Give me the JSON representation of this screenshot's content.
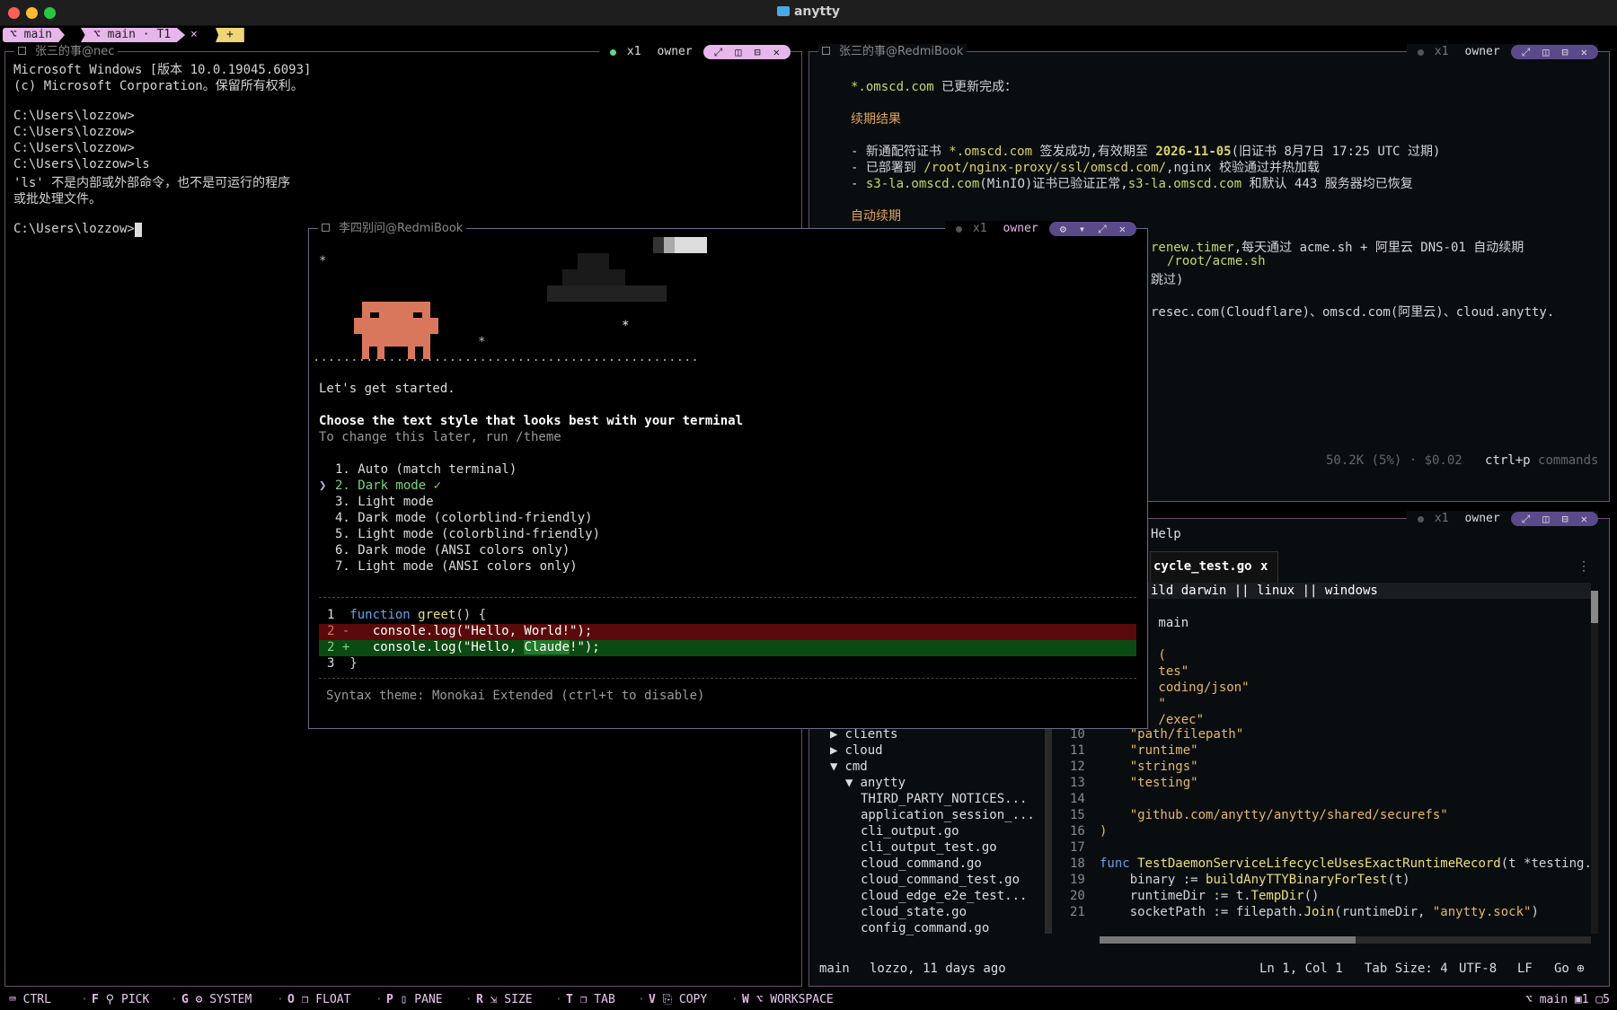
{
  "app": {
    "title": "anytty"
  },
  "tabstrip": {
    "session": "⌥ main",
    "tab": "⌥ main · T1",
    "close": "×",
    "add": "+"
  },
  "panes": {
    "left": {
      "title": "张三的事@nec",
      "x1": "x1",
      "owner": "owner",
      "lines": [
        "Microsoft Windows [版本 10.0.19045.6093]",
        "(c) Microsoft Corporation。保留所有权利。",
        "",
        "C:\\Users\\lozzow>",
        "C:\\Users\\lozzow>",
        "C:\\Users\\lozzow>",
        "C:\\Users\\lozzow>ls",
        "'ls' 不是内部或外部命令，也不是可运行的程序",
        "或批处理文件。",
        "",
        "C:\\Users\\lozzow>"
      ]
    },
    "top_right": {
      "title": "张三的事@RedmiBook",
      "x1": "x1",
      "owner": "owner",
      "l1a": "*.omscd.com",
      "l1b": " 已更新完成：",
      "h1": "续期结果",
      "r1a": "- 新通配符证书 ",
      "r1b": "*.omscd.com",
      "r1c": " 签发成功,有效期至 ",
      "r1d": "2026-11-05",
      "r1e": "(旧证书 8月7日 17:25 UTC 过期)",
      "r2a": "- 已部署到 ",
      "r2b": "/root/nginx-proxy/ssl/omscd.com/",
      "r2c": ",nginx 校验通过并热加载",
      "r3a": "- ",
      "r3b": "s3-la.omscd.com",
      "r3c": "(MinIO)证书已验证正常,",
      "r3d": "s3-la.omscd.com",
      "r3e": " 和默认 443 服务器均已恢复",
      "h2": "自动续期",
      "a1a": "renew.timer",
      "a1b": ",每天通过 acme.sh + 阿里云 DNS-01 自动续期",
      "a2": "/root/acme.sh",
      "a3": "跳过)",
      "a4": "resec.com(Cloudflare)、omscd.com(阿里云)、cloud.anytty.",
      "usage": "50.2K (5%) · $0.02",
      "cmd_key": "ctrl+p",
      "cmd_label": "commands"
    },
    "bottom_right": {
      "x1": "x1",
      "owner": "owner",
      "menu_help": "Help",
      "tab_file": "cycle_test.go",
      "tab_close": "x",
      "more": "⋮",
      "code_top": [
        "ild darwin || linux || windows",
        "",
        " main",
        "",
        " (",
        " tes\"",
        " coding/json\"",
        " \"",
        " /exec\""
      ],
      "tree": [
        {
          "indent": 0,
          "arrow": "▶",
          "name": "clients"
        },
        {
          "indent": 0,
          "arrow": "▶",
          "name": "cloud"
        },
        {
          "indent": 0,
          "arrow": "▼",
          "name": "cmd"
        },
        {
          "indent": 1,
          "arrow": "▼",
          "name": "anytty"
        },
        {
          "indent": 2,
          "arrow": "",
          "name": "THIRD_PARTY_NOTICES..."
        },
        {
          "indent": 2,
          "arrow": "",
          "name": "application_session_..."
        },
        {
          "indent": 2,
          "arrow": "",
          "name": "cli_output.go"
        },
        {
          "indent": 2,
          "arrow": "",
          "name": "cli_output_test.go"
        },
        {
          "indent": 2,
          "arrow": "",
          "name": "cloud_command.go"
        },
        {
          "indent": 2,
          "arrow": "",
          "name": "cloud_command_test.go"
        },
        {
          "indent": 2,
          "arrow": "",
          "name": "cloud_edge_e2e_test..."
        },
        {
          "indent": 2,
          "arrow": "",
          "name": "cloud_state.go"
        },
        {
          "indent": 2,
          "arrow": "",
          "name": "config_command.go"
        }
      ],
      "code": [
        {
          "n": "10",
          "t": "    \"path/filepath\"",
          "c": "str"
        },
        {
          "n": "11",
          "t": "    \"runtime\"",
          "c": "str"
        },
        {
          "n": "12",
          "t": "    \"strings\"",
          "c": "str"
        },
        {
          "n": "13",
          "t": "    \"testing\"",
          "c": "str"
        },
        {
          "n": "14",
          "t": "",
          "c": ""
        },
        {
          "n": "15",
          "t": "    \"github.com/anytty/anytty/shared/securefs\"",
          "c": "str"
        },
        {
          "n": "16",
          "t": ")",
          "c": "str"
        },
        {
          "n": "17",
          "t": "",
          "c": ""
        },
        {
          "n": "18",
          "t": "",
          "c": "fn18"
        },
        {
          "n": "19",
          "t": "",
          "c": "l19"
        },
        {
          "n": "20",
          "t": "",
          "c": "l20"
        },
        {
          "n": "21",
          "t": "",
          "c": "l21"
        }
      ],
      "l18a": "func ",
      "l18b": "TestDaemonServiceLifecycleUsesExactRuntimeRecord",
      "l18c": "(t *testing.",
      "l19a": "    binary := ",
      "l19b": "buildAnyTTYBinaryForTest",
      "l19c": "(t)",
      "l20a": "    runtimeDir := t.",
      "l20b": "TempDir",
      "l20c": "()",
      "l21a": "    socketPath := filepath.",
      "l21b": "Join",
      "l21c": "(runtimeDir, ",
      "l21d": "\"anytty.sock\"",
      "l21e": ")",
      "status_branch": "main",
      "status_blame": "lozzo, 11 days ago",
      "status_pos": "Ln 1, Col 1",
      "status_tab": "Tab Size: 4",
      "status_enc": "UTF-8",
      "status_eol": "LF",
      "status_lang": "Go ⊕"
    }
  },
  "float": {
    "title": "李四别问@RedmiBook",
    "x1": "x1",
    "owner": "owner",
    "star": "*",
    "ground": "..........................................................................................................",
    "intro": "Let's get started.",
    "heading": "Choose the text style that looks best with your terminal",
    "sub": "To change this later, run /theme",
    "options": [
      "1. Auto (match terminal)",
      "2. Dark mode ✓",
      "3. Light mode",
      "4. Dark mode (colorblind-friendly)",
      "5. Light mode (colorblind-friendly)",
      "6. Dark mode (ANSI colors only)",
      "7. Light mode (ANSI colors only)"
    ],
    "cursor": "❯",
    "diff1_n": "1",
    "diff1_a": "function ",
    "diff1_b": "greet",
    "diff1_c": "() {",
    "diff2_n": "2 -",
    "diff2_t": "  console.log(\"Hello, World!\");",
    "diff3_n": "2 +",
    "diff3_a": "  console.log(\"Hello, ",
    "diff3_b": "Claude",
    "diff3_c": "!\");",
    "diff4_n": "3",
    "diff4_t": "}",
    "syntax": "Syntax theme: Monokai Extended (ctrl+t to disable)"
  },
  "bottombar": {
    "items": [
      {
        "key": "",
        "label": "⌨ CTRL"
      },
      {
        "key": "F",
        "label": "⚲ PICK"
      },
      {
        "key": "G",
        "label": "⚙ SYSTEM"
      },
      {
        "key": "O",
        "label": "❐ FLOAT"
      },
      {
        "key": "P",
        "label": "▯ PANE"
      },
      {
        "key": "R",
        "label": "⇲ SIZE"
      },
      {
        "key": "T",
        "label": "❐ TAB"
      },
      {
        "key": "V",
        "label": "⎘ COPY"
      },
      {
        "key": "W",
        "label": "⌥ WORKSPACE"
      }
    ],
    "right": "⌥ main ▣1 ▢5"
  },
  "colors": {
    "accent": "#e7b6ea",
    "add": "#f0d478",
    "diff_del": "#5a0a0a",
    "diff_add": "#0b4a12",
    "crab": "#d9775c"
  }
}
